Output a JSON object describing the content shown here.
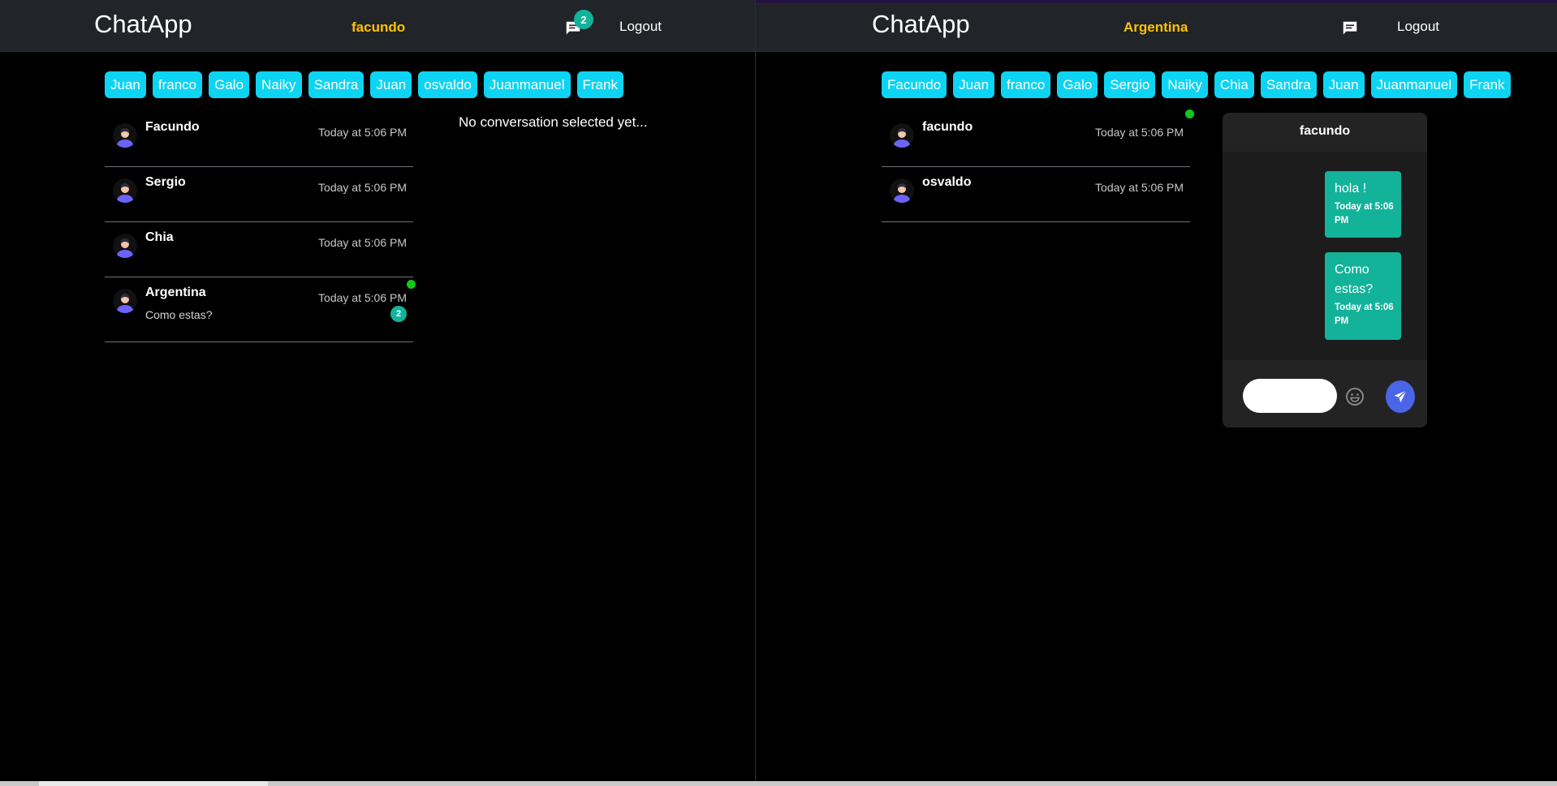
{
  "left_window": {
    "logo": "ChatApp",
    "username": "facundo",
    "notification_count": "2",
    "logout_label": "Logout",
    "user_chips": [
      "Juan",
      "franco",
      "Galo",
      "Naiky",
      "Sandra",
      "Juan",
      "osvaldo",
      "Juanmanuel",
      "Frank"
    ],
    "conversations": [
      {
        "name": "Facundo",
        "time": "Today at 5:06 PM"
      },
      {
        "name": "Sergio",
        "time": "Today at 5:06 PM"
      },
      {
        "name": "Chia",
        "time": "Today at 5:06 PM"
      },
      {
        "name": "Argentina",
        "time": "Today at 5:06 PM",
        "last_message": "Como estas?",
        "unread": "2",
        "online": true
      }
    ],
    "empty_state": "No conversation selected yet..."
  },
  "right_window": {
    "logo": "ChatApp",
    "username": "Argentina",
    "logout_label": "Logout",
    "user_chips": [
      "Facundo",
      "Juan",
      "franco",
      "Galo",
      "Sergio",
      "Naiky",
      "Chia",
      "Sandra",
      "Juan",
      "Juanmanuel",
      "Frank"
    ],
    "conversations": [
      {
        "name": "facundo",
        "time": "Today at 5:06 PM",
        "online": true
      },
      {
        "name": "osvaldo",
        "time": "Today at 5:06 PM"
      }
    ],
    "chat": {
      "recipient": "facundo",
      "messages": [
        {
          "text": "hola !",
          "meta": "Today at 5:06 PM"
        },
        {
          "text": "Como estas?",
          "meta": "Today at 5:06 PM"
        }
      ],
      "input_value": "",
      "input_placeholder": ""
    }
  },
  "colors": {
    "background": "#000000",
    "header": "#212529",
    "username": "#ffc107",
    "chip": "#0dd4f2",
    "badge": "#13b39a",
    "message_bubble": "#13b39a",
    "online": "#10c918",
    "send_button": "#4b65e8"
  },
  "icons": {
    "notifications": "chat-bubble-icon",
    "avatar": "user-avatar-icon",
    "emoji": "smiley-icon",
    "send": "paper-plane-icon"
  }
}
